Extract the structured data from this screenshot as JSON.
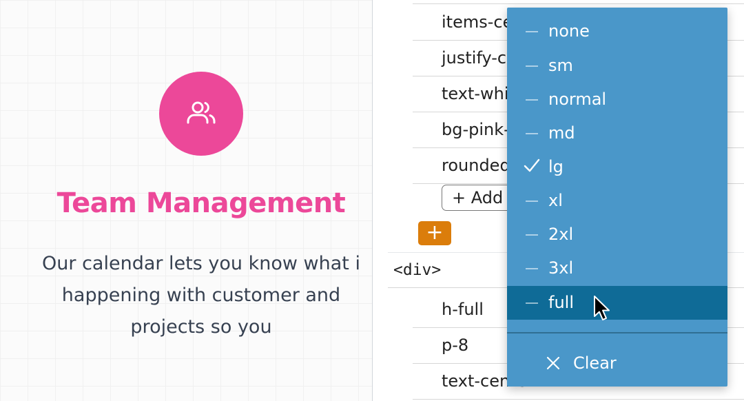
{
  "preview": {
    "avatar_icon": "users-icon",
    "title": "Team Management",
    "description_lines": [
      "Our calendar lets you know what i",
      "happening with customer and",
      "projects so you"
    ],
    "colors": {
      "accent": "#ec4899",
      "text": "#374151"
    }
  },
  "inspector": {
    "class_rows_top": [
      "items-ce",
      "justify-c",
      "text-whi",
      "bg-pink-",
      "rounded"
    ],
    "add_label": "+ Add",
    "add_element_button": "+",
    "element_tag": "<div>",
    "class_rows_bottom": [
      "h-full",
      "p-8",
      "text-center"
    ]
  },
  "dropdown": {
    "options": [
      {
        "label": "none",
        "selected": false
      },
      {
        "label": "sm",
        "selected": false
      },
      {
        "label": "normal",
        "selected": false
      },
      {
        "label": "md",
        "selected": false
      },
      {
        "label": "lg",
        "selected": true
      },
      {
        "label": "xl",
        "selected": false
      },
      {
        "label": "2xl",
        "selected": false
      },
      {
        "label": "3xl",
        "selected": false
      },
      {
        "label": "full",
        "selected": false
      }
    ],
    "hovered": "full",
    "clear_label": "Clear",
    "colors": {
      "background": "#4a97c9",
      "hover": "#0f6b97"
    }
  }
}
